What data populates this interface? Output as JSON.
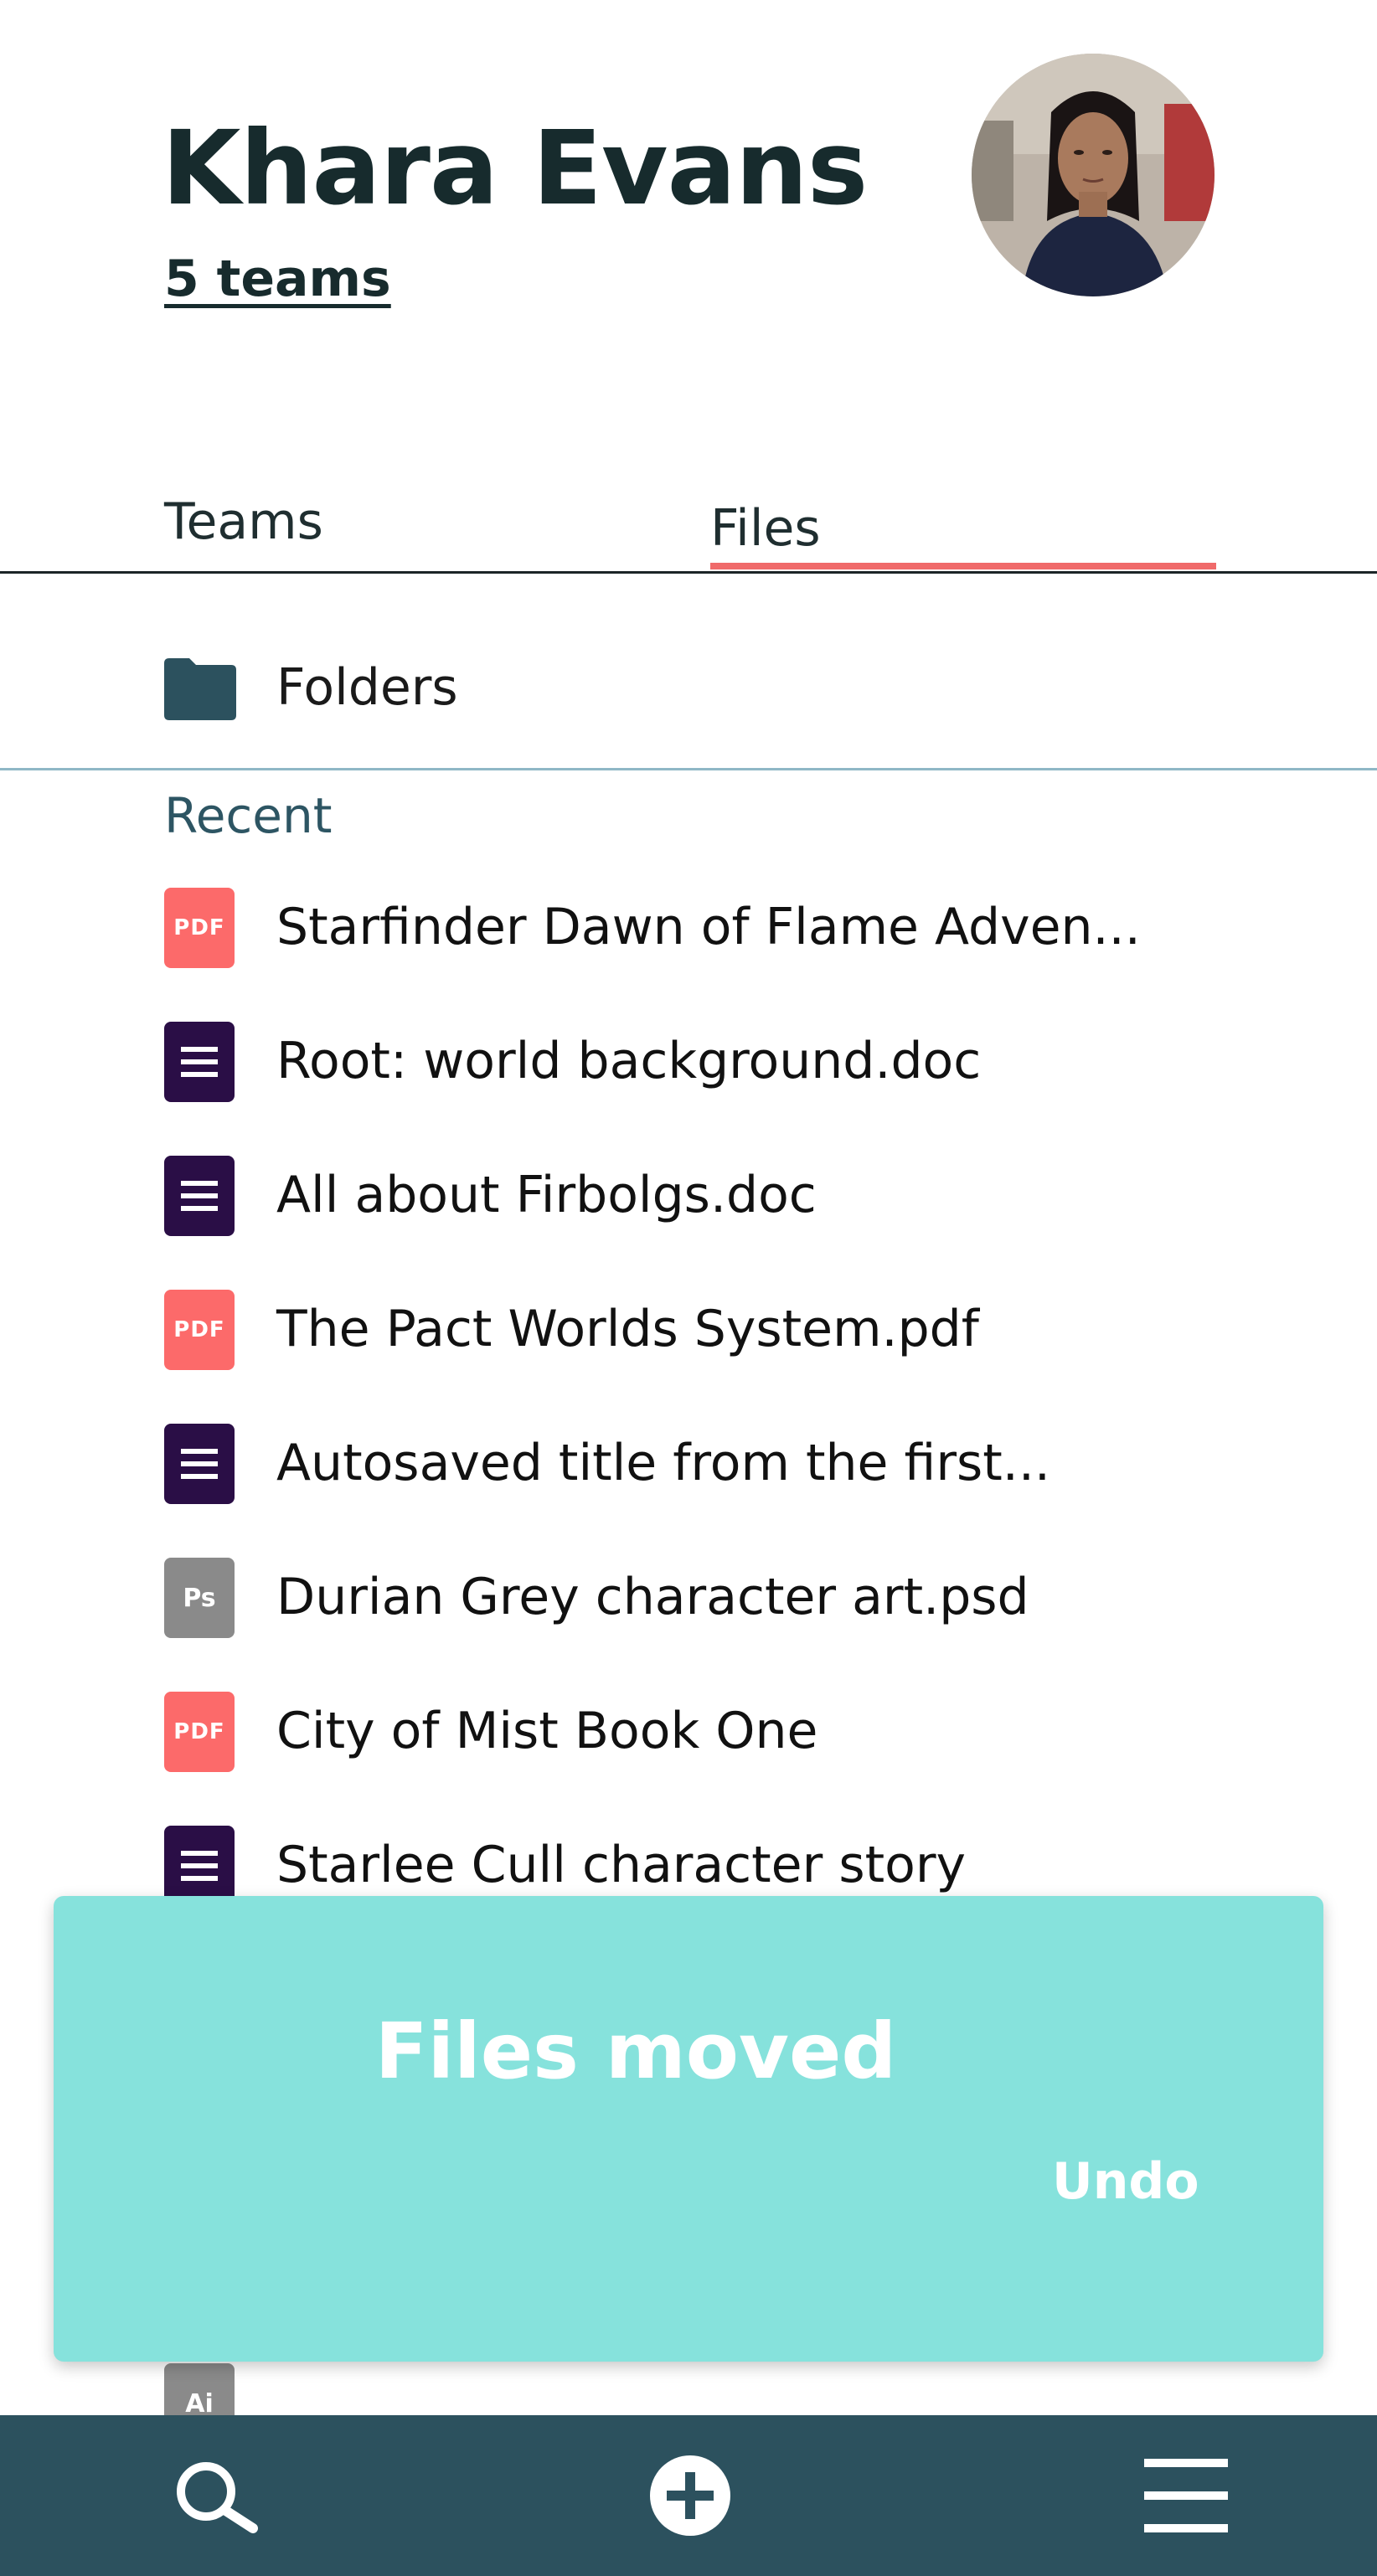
{
  "profile": {
    "name": "Khara Evans",
    "teams_link": "5 teams",
    "avatar": "profile-photo"
  },
  "tabs": [
    {
      "label": "Teams",
      "active": false
    },
    {
      "label": "Files",
      "active": true
    }
  ],
  "folders": {
    "label": "Folders",
    "icon": "folder-icon"
  },
  "recent": {
    "label": "Recent",
    "files": [
      {
        "name": "Starfinder Dawn of Flame Adven...",
        "type": "pdf",
        "icon_text": "PDF"
      },
      {
        "name": "Root: world background.doc",
        "type": "doc",
        "icon_text": ""
      },
      {
        "name": "All about Firbolgs.doc",
        "type": "doc",
        "icon_text": ""
      },
      {
        "name": "The Pact Worlds System.pdf",
        "type": "pdf",
        "icon_text": "PDF"
      },
      {
        "name": "Autosaved title from the first...",
        "type": "doc",
        "icon_text": ""
      },
      {
        "name": "Durian Grey character art.psd",
        "type": "psd",
        "icon_text": "Ps"
      },
      {
        "name": "City of Mist Book One",
        "type": "pdf",
        "icon_text": "PDF"
      },
      {
        "name": "Starlee Cull character story",
        "type": "doc",
        "icon_text": ""
      }
    ],
    "partial_file": {
      "type": "ai",
      "icon_text": "Ai"
    }
  },
  "toast": {
    "message": "Files moved",
    "action": "Undo"
  },
  "bottom_nav": [
    {
      "icon": "search-icon"
    },
    {
      "icon": "add-icon"
    },
    {
      "icon": "menu-icon"
    }
  ],
  "colors": {
    "accent": "#f06a6a",
    "nav_bg": "#2c515e",
    "toast_bg": "#86e2dc",
    "pdf": "#fc6a6a",
    "doc": "#2a0e46",
    "ps": "#8a8a8a"
  }
}
